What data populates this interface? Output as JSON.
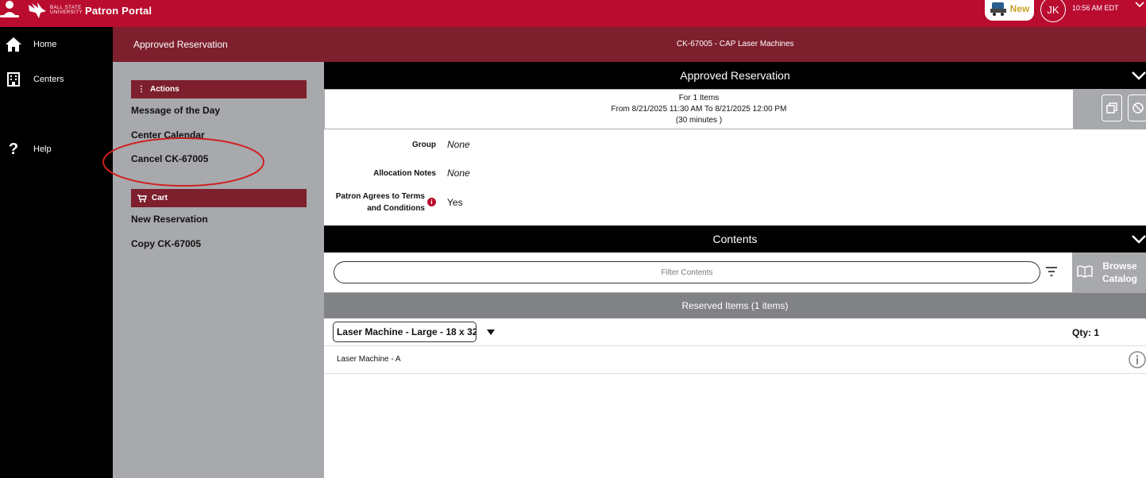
{
  "topbar": {
    "brand": "BALL STATE UNIVERSITY",
    "portal_title": "Patron Portal",
    "new_label": "New",
    "user_initials": "JK",
    "user_time": "10:56 AM EDT",
    "colors": {
      "primary": "#ba0c2f",
      "secondary": "#7d1f2d",
      "gold": "#c9a227"
    }
  },
  "nav": {
    "items": [
      {
        "label": "Home",
        "icon": "home-icon"
      },
      {
        "label": "Centers",
        "icon": "building-icon"
      },
      {
        "label": "Help",
        "icon": "question-icon"
      }
    ]
  },
  "subheader": {
    "title": "Approved Reservation",
    "reservation": "CK-67005 - CAP Laser Machines"
  },
  "actions": {
    "heading": "Actions",
    "links": [
      "Message of the Day",
      "Center Calendar",
      "Cancel CK-67005"
    ],
    "cart_heading": "Cart",
    "cart_links": [
      "New Reservation",
      "Copy CK-67005"
    ]
  },
  "reservation": {
    "section_title": "Approved Reservation",
    "items_line": "For 1 Items",
    "time_line": "From 8/21/2025 11:30 AM To 8/21/2025 12:00 PM",
    "duration_line": "(30 minutes )",
    "group_label": "Group",
    "group_value": "None",
    "notes_label": "Allocation Notes",
    "notes_value": "None",
    "terms_label_1": "Patron Agrees to Terms",
    "terms_label_2": "and Conditions",
    "terms_value": "Yes"
  },
  "contents": {
    "section_title": "Contents",
    "filter_placeholder": "Filter Contents",
    "browse_label_1": "Browse",
    "browse_label_2": "Catalog",
    "reserved_header": "Reserved Items (1 items)",
    "item_name": "Laser Machine - Large - 18 x 32",
    "qty": "Qty: 1",
    "unit_name": "Laser Machine - A"
  }
}
